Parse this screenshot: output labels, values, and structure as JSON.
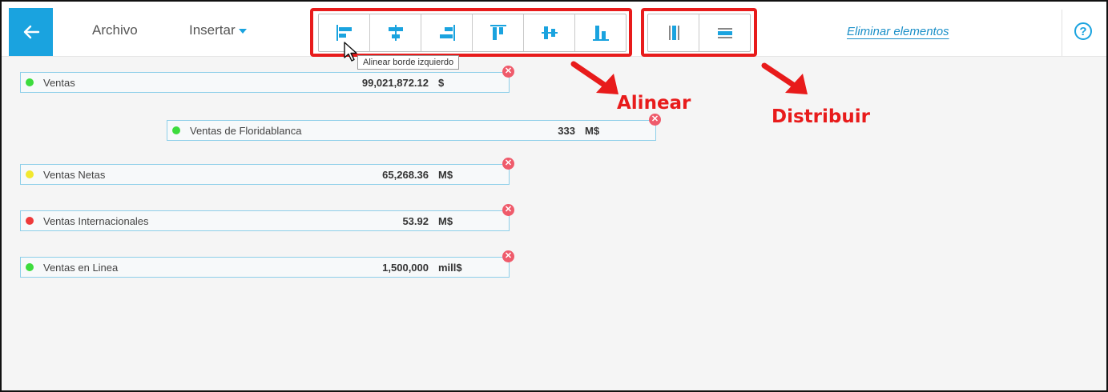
{
  "toolbar": {
    "menu": {
      "archivo": "Archivo",
      "insertar": "Insertar"
    },
    "align_buttons": [
      {
        "icon": "align-left-edge-icon"
      },
      {
        "icon": "align-center-horizontal-icon"
      },
      {
        "icon": "align-right-edge-icon"
      },
      {
        "icon": "align-top-edge-icon"
      },
      {
        "icon": "align-middle-vertical-icon"
      },
      {
        "icon": "align-bottom-edge-icon"
      }
    ],
    "distribute_buttons": [
      {
        "icon": "distribute-horizontal-icon"
      },
      {
        "icon": "distribute-vertical-icon"
      }
    ],
    "delete_label": "Eliminar elementos",
    "help_label": "?",
    "tooltip": "Alinear borde izquierdo"
  },
  "annotations": {
    "align": "Alinear",
    "distribute": "Distribuir"
  },
  "colors": {
    "accent": "#1aa3df",
    "annotation": "#e81b1b",
    "card_border": "#8ecfe9"
  },
  "cards": [
    {
      "name": "Ventas",
      "value": "99,021,872.12",
      "unit": "$",
      "status_color": "#3ddc3d"
    },
    {
      "name": "Ventas de Floridablanca",
      "value": "333",
      "unit": "M$",
      "status_color": "#3ddc3d"
    },
    {
      "name": "Ventas Netas",
      "value": "65,268.36",
      "unit": "M$",
      "status_color": "#f2e830"
    },
    {
      "name": "Ventas Internacionales",
      "value": "53.92",
      "unit": "M$",
      "status_color": "#ee3b3b"
    },
    {
      "name": "Ventas en Linea",
      "value": "1,500,000",
      "unit": "mill$",
      "status_color": "#3ddc3d"
    }
  ]
}
